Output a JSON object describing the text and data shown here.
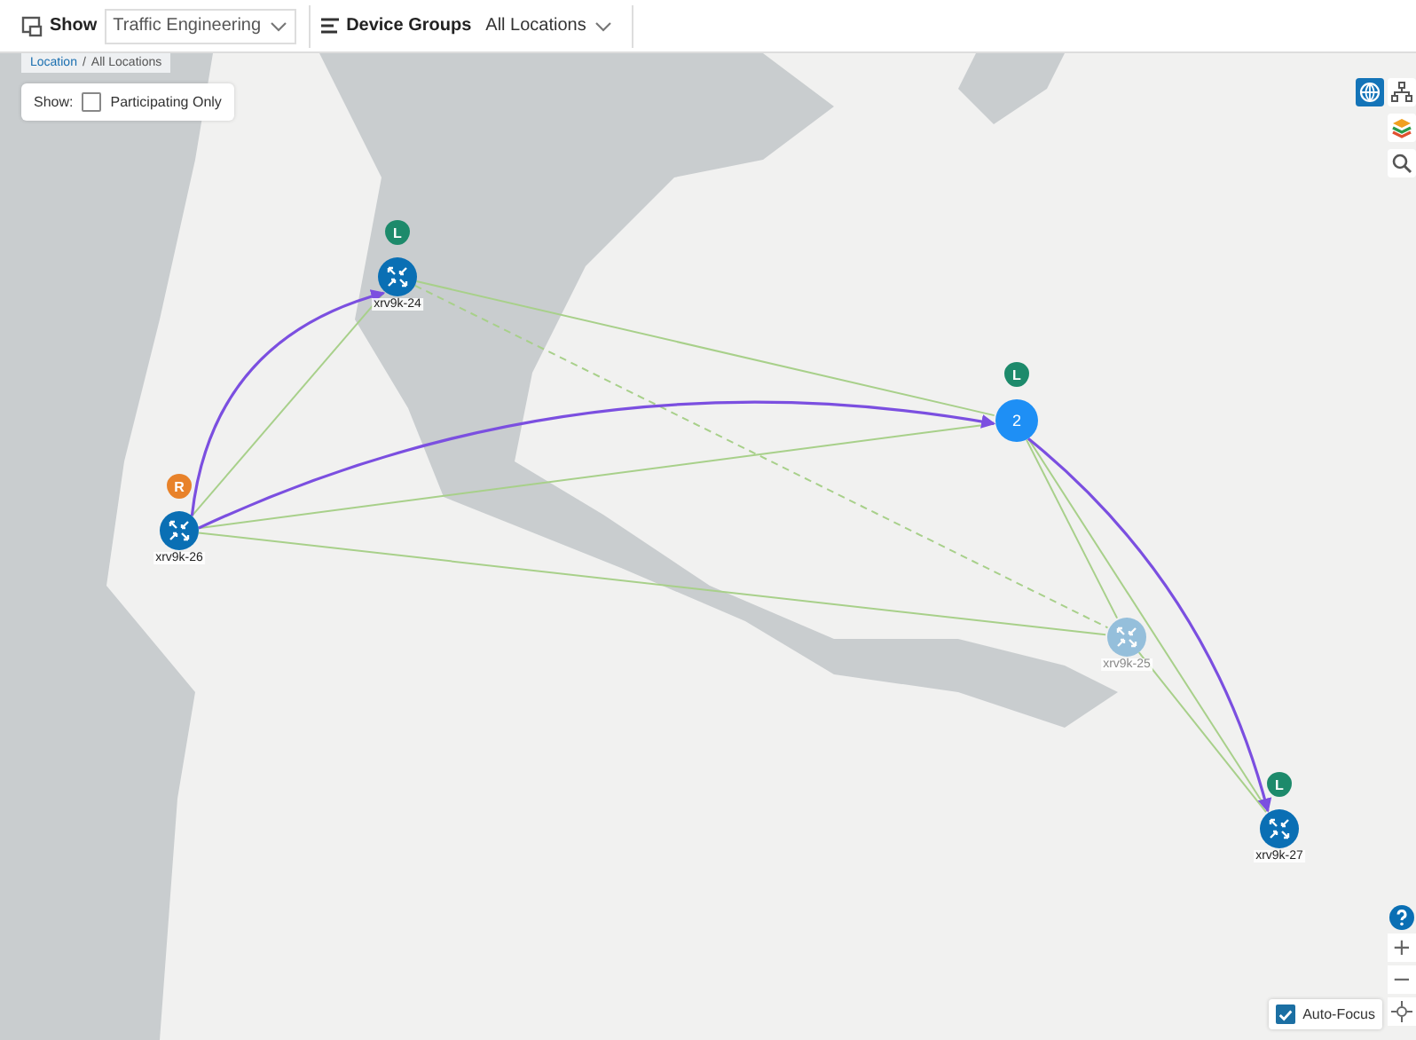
{
  "toolbar": {
    "show_label": "Show",
    "show_value": "Traffic Engineering",
    "groups_label": "Device Groups",
    "groups_value": "All Locations"
  },
  "breadcrumb": {
    "link": "Location",
    "separator": "/",
    "current": "All Locations"
  },
  "filter": {
    "label": "Show:",
    "option": "Participating Only",
    "checked": false
  },
  "nodes": [
    {
      "kind": "device",
      "label": "xrv9k-24",
      "faded": false,
      "pin": {
        "letter": "L",
        "color": "#1d8a6b"
      }
    },
    {
      "kind": "device",
      "label": "xrv9k-26",
      "faded": false,
      "pin": {
        "letter": "R",
        "color": "#e8822a"
      }
    },
    {
      "kind": "cluster",
      "count": "2",
      "pin": {
        "letter": "L",
        "color": "#1d8a6b"
      }
    },
    {
      "kind": "device",
      "label": "xrv9k-25",
      "faded": true
    },
    {
      "kind": "device",
      "label": "xrv9k-27",
      "faded": false,
      "pin": {
        "letter": "L",
        "color": "#1d8a6b"
      }
    }
  ],
  "links": [
    {
      "kind": "link"
    },
    {
      "kind": "dashed"
    },
    {
      "kind": "link"
    },
    {
      "kind": "link"
    },
    {
      "kind": "link"
    },
    {
      "kind": "link"
    },
    {
      "kind": "link"
    },
    {
      "kind": "link"
    },
    {
      "kind": "te-path"
    },
    {
      "kind": "te-path"
    },
    {
      "kind": "te-path"
    }
  ],
  "map_controls": [
    {
      "kind": "globe",
      "selected": true
    },
    {
      "kind": "topology",
      "selected": false
    },
    {
      "kind": "layers",
      "selected": false
    },
    {
      "kind": "search",
      "selected": false
    }
  ],
  "zoom_controls": [
    {
      "kind": "help"
    },
    {
      "kind": "text",
      "text": "+"
    },
    {
      "kind": "text",
      "text": "−"
    },
    {
      "kind": "recenter"
    }
  ],
  "auto_focus": {
    "label": "Auto-Focus",
    "checked": true
  }
}
